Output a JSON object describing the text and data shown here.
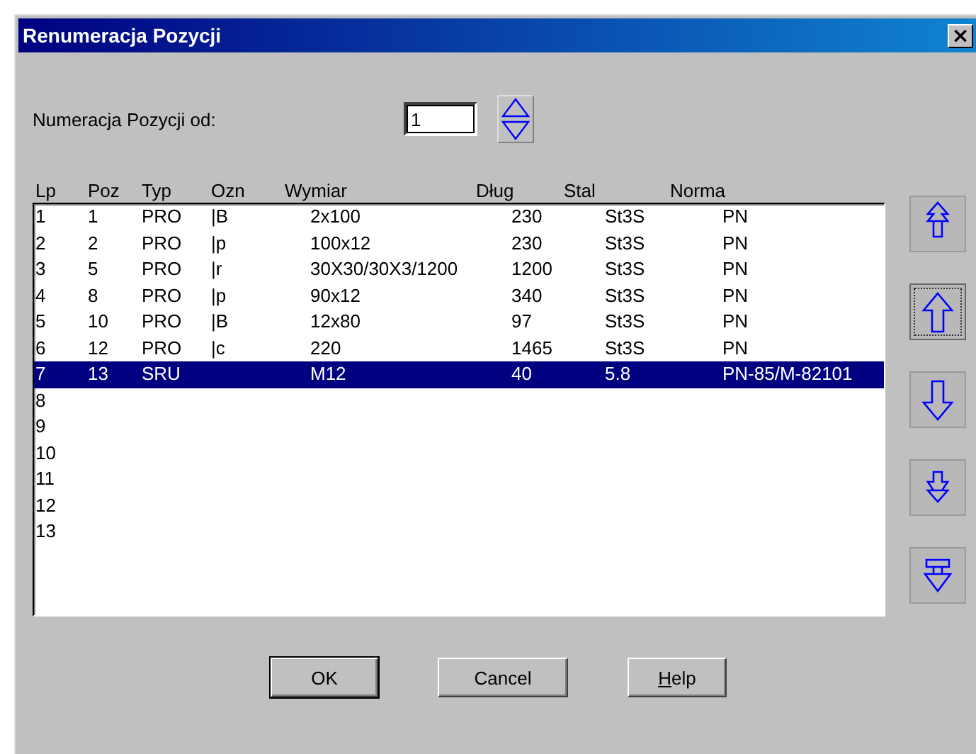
{
  "window": {
    "title": "Renumeracja Pozycji",
    "close": "×"
  },
  "start": {
    "label": "Numeracja Pozycji od:",
    "value": "1"
  },
  "table": {
    "columns": [
      "Lp",
      "Poz",
      "Typ",
      "Ozn",
      "Wymiar",
      "Dług",
      "Stal",
      "Norma"
    ],
    "rows": [
      {
        "selected": false,
        "cells": [
          "1",
          "1",
          "PRO",
          "|B",
          "2x100",
          "230",
          "St3S",
          "PN"
        ]
      },
      {
        "selected": false,
        "cells": [
          "2",
          "2",
          "PRO",
          "|p",
          "100x12",
          "230",
          "St3S",
          "PN"
        ]
      },
      {
        "selected": false,
        "cells": [
          "3",
          "5",
          "PRO",
          "|r",
          "30X30/30X3/1200",
          "1200",
          "St3S",
          "PN"
        ]
      },
      {
        "selected": false,
        "cells": [
          "4",
          "8",
          "PRO",
          "|p",
          "90x12",
          "340",
          "St3S",
          "PN"
        ]
      },
      {
        "selected": false,
        "cells": [
          "5",
          "10",
          "PRO",
          "|B",
          "12x80",
          "97",
          "St3S",
          "PN"
        ]
      },
      {
        "selected": false,
        "cells": [
          "6",
          "12",
          "PRO",
          "|c",
          "220",
          "1465",
          "St3S",
          "PN"
        ]
      },
      {
        "selected": true,
        "cells": [
          "7",
          "13",
          "SRU",
          null,
          "M12",
          "40",
          "5.8",
          "PN-85/M-82101"
        ]
      },
      {
        "selected": false,
        "cells": [
          "8"
        ]
      },
      {
        "selected": false,
        "cells": [
          "9"
        ]
      },
      {
        "selected": false,
        "cells": [
          "10"
        ]
      },
      {
        "selected": false,
        "cells": [
          "11"
        ]
      },
      {
        "selected": false,
        "cells": [
          "12"
        ]
      },
      {
        "selected": false,
        "cells": [
          "13"
        ]
      }
    ]
  },
  "move_buttons": [
    {
      "kind": "top",
      "focused": false
    },
    {
      "kind": "up",
      "focused": true
    },
    {
      "kind": "down",
      "focused": false
    },
    {
      "kind": "bottom",
      "focused": false
    },
    {
      "kind": "last",
      "focused": false
    }
  ],
  "buttons": [
    {
      "label": "OK",
      "default": true,
      "underline_first": false
    },
    {
      "label": "Cancel",
      "default": false,
      "underline_first": false
    },
    {
      "label": "Help",
      "default": false,
      "underline_first": true
    }
  ]
}
